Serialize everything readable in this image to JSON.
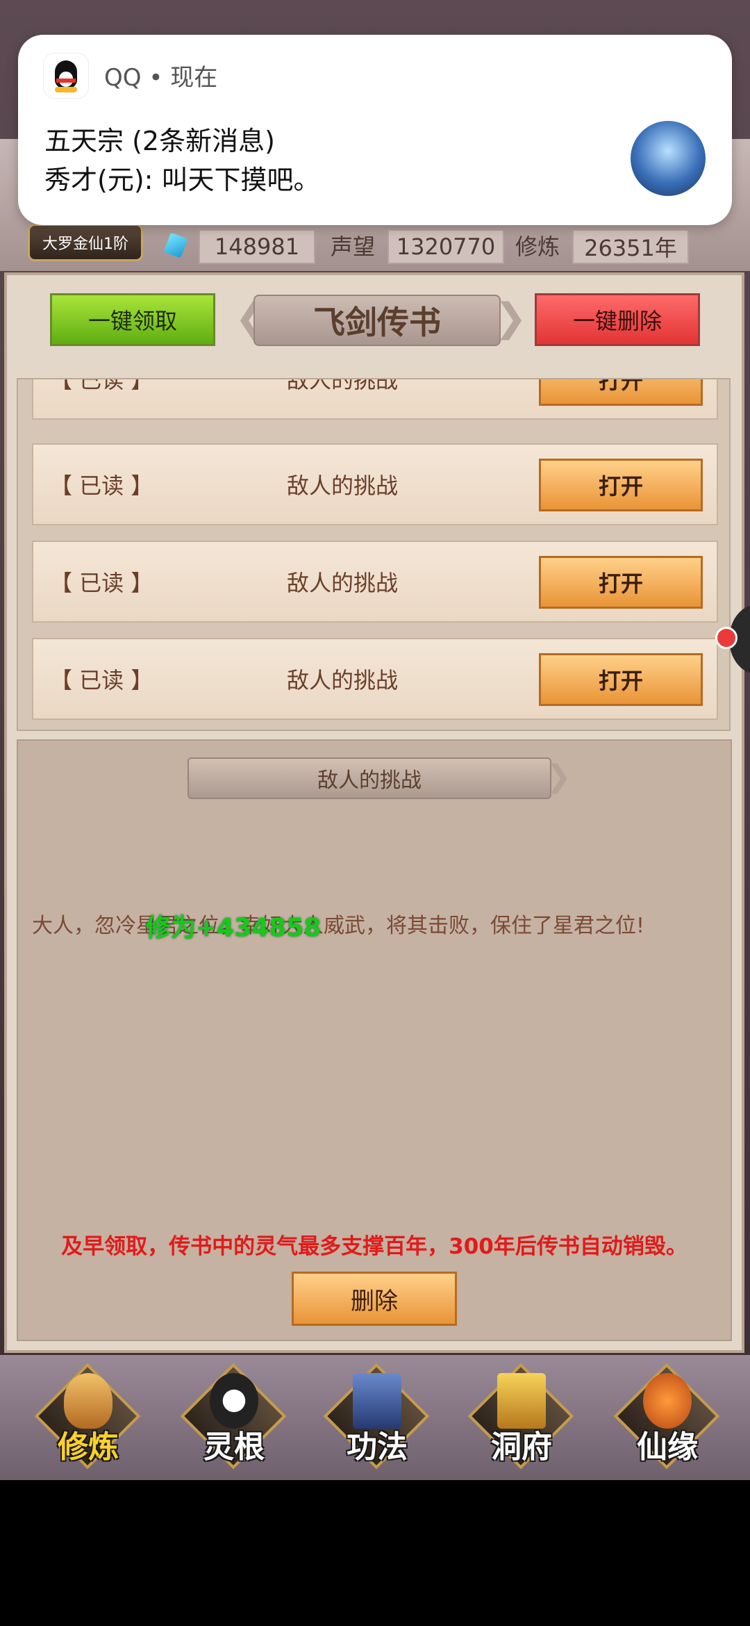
{
  "notification": {
    "app": "QQ • 现在",
    "title": "五天宗 (2条新消息)",
    "message": "秀才(元): 叫天下摸吧。"
  },
  "header": {
    "rank": "大罗金仙1阶",
    "gems": "148981",
    "reputation_label": "声望",
    "reputation": "1320770",
    "cultivation_label": "修炼",
    "cultivation": "26351年"
  },
  "panel": {
    "title": "飞剑传书",
    "claim_all": "一键领取",
    "delete_all": "一键删除"
  },
  "mails": [
    {
      "status": "【 已读 】",
      "title": "敌人的挑战",
      "action": "打开"
    },
    {
      "status": "【 已读 】",
      "title": "敌人的挑战",
      "action": "打开"
    },
    {
      "status": "【 已读 】",
      "title": "敌人的挑战",
      "action": "打开"
    },
    {
      "status": "【 已读 】",
      "title": "敌人的挑战",
      "action": "打开"
    }
  ],
  "detail": {
    "title": "敌人的挑战",
    "body": "大人，忽冷星君之位，幸好大人威武，将其击败，保住了星君之位!",
    "float_text": "修为+434858",
    "warning": "及早领取，传书中的灵气最多支撑百年，300年后传书自动销毁。",
    "delete": "删除"
  },
  "nav": [
    {
      "label": "修炼",
      "icon": "monk-icon",
      "active": true
    },
    {
      "label": "灵根",
      "icon": "taiji-sword-icon"
    },
    {
      "label": "功法",
      "icon": "book-icon"
    },
    {
      "label": "洞府",
      "icon": "pagoda-icon"
    },
    {
      "label": "仙缘",
      "icon": "gourd-icon"
    }
  ]
}
